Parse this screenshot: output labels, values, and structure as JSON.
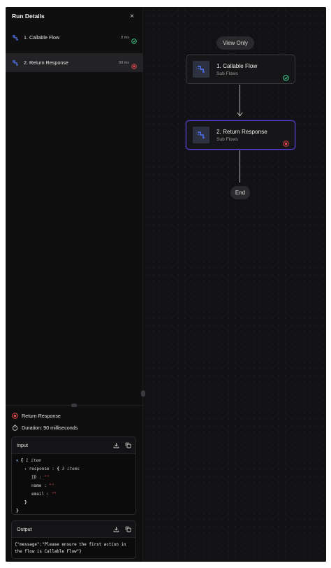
{
  "panel": {
    "title": "Run Details",
    "close_glyph": "×"
  },
  "steps": [
    {
      "label": "1. Callable Flow",
      "duration": "0 ms",
      "status": "success",
      "icon": "flow-step-icon",
      "status_icon": "check-circle-icon"
    },
    {
      "label": "2. Return Response",
      "duration": "90 ms",
      "status": "error",
      "icon": "flow-step-icon",
      "status_icon": "error-circle-icon"
    }
  ],
  "details": {
    "status_label": "Return Response",
    "duration_label": "Duration: 90 milliseconds",
    "status_icon": "error-circle-icon",
    "duration_icon": "stopwatch-icon"
  },
  "input": {
    "title": "Input",
    "actions": [
      "download-icon",
      "copy-icon"
    ],
    "tree": {
      "root_meta": "1 item",
      "root_open": "{",
      "response_key": "response",
      "response_open": "{",
      "response_meta": "3 items",
      "fields": [
        {
          "key": "ID",
          "value": "\"\""
        },
        {
          "key": "name",
          "value": "\"\""
        },
        {
          "key": "email",
          "value": "\"\""
        }
      ],
      "close_inner": "}",
      "close_outer": "}"
    }
  },
  "output": {
    "title": "Output",
    "actions": [
      "download-icon",
      "copy-icon"
    ],
    "text": "{\"message\":\"Please ensure the first action in the flow is Callable Flow\"}"
  },
  "canvas": {
    "view_only_label": "View Only",
    "end_label": "End",
    "nodes": [
      {
        "title": "1. Callable Flow",
        "subtitle": "Sub Flows",
        "status": "success"
      },
      {
        "title": "2. Return Response",
        "subtitle": "Sub Flows",
        "status": "error"
      }
    ]
  },
  "colors": {
    "success": "#3ecf8e",
    "error": "#e5484d",
    "selected_border": "#5b3fd8",
    "accent_icon": "#3b5bdb"
  }
}
